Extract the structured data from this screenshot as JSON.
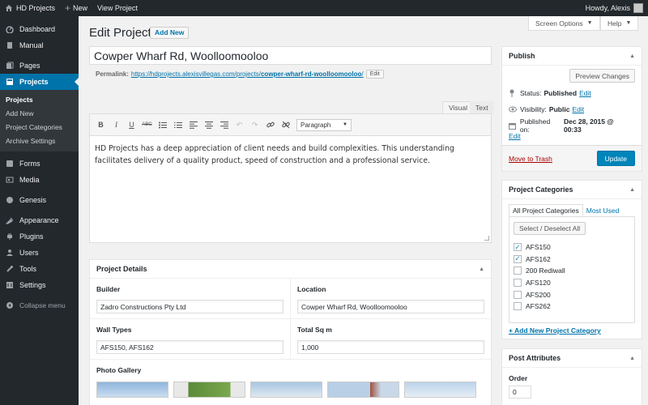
{
  "admin_bar": {
    "site_name": "HD Projects",
    "new_label": "New",
    "view_label": "View Project",
    "greeting": "Howdy, Alexis"
  },
  "sidebar": {
    "items": [
      {
        "label": "Dashboard",
        "icon": "dashboard-icon"
      },
      {
        "label": "Manual",
        "icon": "book-icon"
      },
      {
        "label": "Pages",
        "icon": "pages-icon"
      },
      {
        "label": "Projects",
        "icon": "projects-icon"
      },
      {
        "label": "Forms",
        "icon": "forms-icon"
      },
      {
        "label": "Media",
        "icon": "media-icon"
      },
      {
        "label": "Genesis",
        "icon": "genesis-icon"
      },
      {
        "label": "Appearance",
        "icon": "appearance-icon"
      },
      {
        "label": "Plugins",
        "icon": "plugins-icon"
      },
      {
        "label": "Users",
        "icon": "users-icon"
      },
      {
        "label": "Tools",
        "icon": "tools-icon"
      },
      {
        "label": "Settings",
        "icon": "settings-icon"
      },
      {
        "label": "Collapse menu",
        "icon": "collapse-icon"
      }
    ],
    "submenu": [
      "Projects",
      "Add New",
      "Project Categories",
      "Archive Settings"
    ]
  },
  "screen_options": "Screen Options",
  "help": "Help",
  "page": {
    "title": "Edit Project",
    "add_new": "Add New",
    "post_title": "Cowper Wharf Rd, Woolloomooloo",
    "permalink_label": "Permalink:",
    "permalink_base": "https://hdprojects.alexisvillegas.com/projects/",
    "permalink_slug": "cowper-wharf-rd-woolloomooloo",
    "permalink_trailing": "/",
    "permalink_edit": "Edit"
  },
  "editor": {
    "tab_visual": "Visual",
    "tab_text": "Text",
    "format": "Paragraph",
    "content": "HD Projects has a deep appreciation of client needs and build complexities. This understanding facilitates delivery of a quality product, speed of construction and a professional service."
  },
  "project_details": {
    "title": "Project Details",
    "builder_label": "Builder",
    "builder_value": "Zadro Constructions Pty Ltd",
    "location_label": "Location",
    "location_value": "Cowper Wharf Rd, Woolloomooloo",
    "wall_label": "Wall Types",
    "wall_value": "AFS150, AFS162",
    "sqm_label": "Total Sq m",
    "sqm_value": "1,000",
    "gallery_label": "Photo Gallery"
  },
  "publish": {
    "title": "Publish",
    "preview": "Preview Changes",
    "status_label": "Status:",
    "status_value": "Published",
    "visibility_label": "Visibility:",
    "visibility_value": "Public",
    "published_label": "Published on:",
    "published_value": "Dec 28, 2015 @ 00:33",
    "edit": "Edit",
    "trash": "Move to Trash",
    "update": "Update"
  },
  "categories": {
    "title": "Project Categories",
    "tab_all": "All Project Categories",
    "tab_used": "Most Used",
    "select_all": "Select / Deselect All",
    "items": [
      {
        "label": "AFS150",
        "checked": true
      },
      {
        "label": "AFS162",
        "checked": true
      },
      {
        "label": "200 Rediwall",
        "checked": false
      },
      {
        "label": "AFS120",
        "checked": false
      },
      {
        "label": "AFS200",
        "checked": false
      },
      {
        "label": "AFS262",
        "checked": false
      }
    ],
    "add_new": "+ Add New Project Category"
  },
  "attributes": {
    "title": "Post Attributes",
    "order_label": "Order",
    "order_value": "0"
  },
  "colors": {
    "admin_dark": "#23282d",
    "accent": "#0073aa",
    "button_primary": "#0085ba",
    "trash": "#aa0000"
  }
}
